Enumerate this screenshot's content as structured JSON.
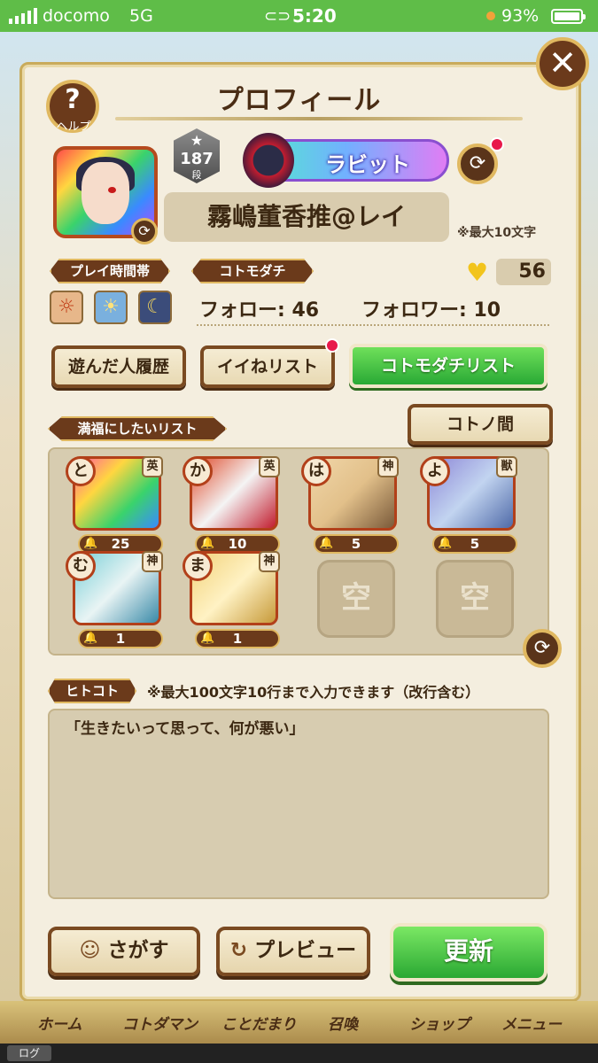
{
  "status_bar": {
    "carrier": "docomo",
    "network": "5G",
    "time": "5:20",
    "battery": "93%"
  },
  "header": {
    "title": "プロフィール",
    "help_label": "ヘルプ",
    "close_symbol": "✕"
  },
  "profile": {
    "rank_number": "187",
    "rank_unit": "段",
    "title_badge": "ラビット",
    "name": "霧嶋董香推@レイ",
    "name_note": "※最大10文字",
    "play_time_label": "プレイ時間帯",
    "kotomodachi_label": "コトモダチ",
    "heart_count": "56",
    "follow_text": "フォロー: 46",
    "follower_text": "フォロワー: 10"
  },
  "buttons": {
    "played_history": "遊んだ人履歴",
    "like_list": "イイねリスト",
    "kotomodachi_list": "コトモダチリスト",
    "kotonoma": "コトノ間",
    "search": "さがす",
    "preview": "プレビュー",
    "update": "更新"
  },
  "fav_list": {
    "label": "満福にしたいリスト",
    "empty_label": "空",
    "cards": [
      {
        "kana": "と",
        "type": "英",
        "count": "25",
        "color": "#ff5aa0"
      },
      {
        "kana": "か",
        "type": "英",
        "count": "10",
        "color": "#e04a2a"
      },
      {
        "kana": "は",
        "type": "神",
        "count": "5",
        "color": "#f0d6a8"
      },
      {
        "kana": "よ",
        "type": "獣",
        "count": "5",
        "color": "#8e88d8"
      },
      {
        "kana": "む",
        "type": "神",
        "count": "1",
        "color": "#7ad0d8"
      },
      {
        "kana": "ま",
        "type": "神",
        "count": "1",
        "color": "#f2d27a"
      }
    ]
  },
  "hitokoto": {
    "label": "ヒトコト",
    "note": "※最大100文字10行まで入力できます（改行含む）",
    "text": "「生きたいって思って、何が悪い」"
  },
  "nav": {
    "items": [
      "ホーム",
      "コトダマン",
      "ことだまり",
      "召喚",
      "ショップ",
      "メニュー"
    ],
    "log": "ログ"
  }
}
